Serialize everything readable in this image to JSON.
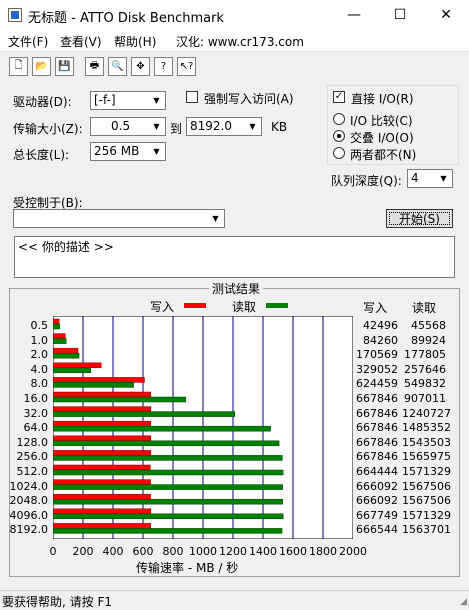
{
  "window": {
    "title": "无标题 - ATTO Disk Benchmark",
    "min_glyph": "—",
    "max_glyph": "☐",
    "close_glyph": "✕"
  },
  "menu": [
    "文件(F)",
    "查看(V)",
    "帮助(H)",
    "汉化: www.cr173.com"
  ],
  "toolbar": {
    "buttons": [
      {
        "name": "new-icon",
        "glyph": "🗋"
      },
      {
        "name": "open-icon",
        "glyph": "📂"
      },
      {
        "name": "save-icon",
        "glyph": "💾"
      },
      {
        "name": "print-icon",
        "glyph": "🖶"
      },
      {
        "name": "print-preview-icon",
        "glyph": "🔍"
      },
      {
        "name": "move-icon",
        "glyph": "✥"
      },
      {
        "name": "help-icon",
        "glyph": "?"
      },
      {
        "name": "context-help-icon",
        "glyph": "↖?"
      }
    ]
  },
  "settings": {
    "drive_label": "驱动器(D):",
    "drive_value": "[-f-]",
    "force_write_label": "强制写入访问(A)",
    "direct_io_label": "直接 I/O(R)",
    "transfer_label": "传输大小(Z):",
    "transfer_from": "0.5",
    "to_label": "到",
    "transfer_to": "8192.0",
    "kb_label": "KB",
    "total_label": "总长度(L):",
    "total_value": "256 MB",
    "io_compare_label": "I/O 比较(C)",
    "overlap_io_label": "交叠 I/O(O)",
    "neither_label": "两者都不(N)",
    "queue_label": "队列深度(Q):",
    "queue_value": "4",
    "controlled_label": "受控制于(B):",
    "controlled_value": "",
    "start_label": "开始(S)",
    "description": "<< 你的描述  >>"
  },
  "chart_data": {
    "type": "bar",
    "title": "测试结果",
    "legend_write": "写入",
    "legend_read": "读取",
    "col_write": "写入",
    "col_read": "读取",
    "xlabel": "传输速率 - MB / 秒",
    "xlim": [
      0,
      2000
    ],
    "xticks": [
      "0",
      "200",
      "400",
      "600",
      "800",
      "1000",
      "1200",
      "1400",
      "1600",
      "1800",
      "2000"
    ],
    "categories": [
      "0.5",
      "1.0",
      "2.0",
      "4.0",
      "8.0",
      "16.0",
      "32.0",
      "64.0",
      "128.0",
      "256.0",
      "512.0",
      "1024.0",
      "2048.0",
      "4096.0",
      "8192.0"
    ],
    "series": [
      {
        "name": "写入",
        "color": "#ff0000",
        "values": [
          42496,
          84260,
          170569,
          329052,
          624459,
          667846,
          667846,
          667846,
          667846,
          667846,
          664444,
          666092,
          666092,
          667749,
          666544
        ]
      },
      {
        "name": "读取",
        "color": "#008000",
        "values": [
          45568,
          89924,
          177805,
          257646,
          549832,
          907011,
          1240727,
          1485352,
          1543503,
          1565975,
          1571329,
          1567506,
          1567506,
          1571329,
          1563701
        ]
      }
    ]
  },
  "status": "要获得帮助, 请按 F1"
}
